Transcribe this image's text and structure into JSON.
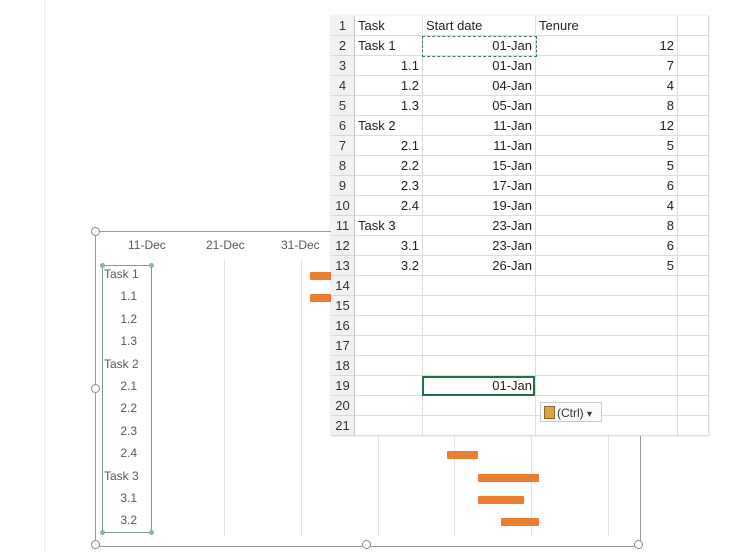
{
  "sheet": {
    "header": {
      "num": "1",
      "a": "Task",
      "b": "Start date",
      "c": "Tenure"
    },
    "rows": [
      {
        "num": "2",
        "a": "Task 1",
        "b": "01-Jan",
        "c": "12",
        "indent": false
      },
      {
        "num": "3",
        "a": "1.1",
        "b": "01-Jan",
        "c": "7",
        "indent": true
      },
      {
        "num": "4",
        "a": "1.2",
        "b": "04-Jan",
        "c": "4",
        "indent": true
      },
      {
        "num": "5",
        "a": "1.3",
        "b": "05-Jan",
        "c": "8",
        "indent": true
      },
      {
        "num": "6",
        "a": "Task 2",
        "b": "11-Jan",
        "c": "12",
        "indent": false
      },
      {
        "num": "7",
        "a": "2.1",
        "b": "11-Jan",
        "c": "5",
        "indent": true
      },
      {
        "num": "8",
        "a": "2.2",
        "b": "15-Jan",
        "c": "5",
        "indent": true
      },
      {
        "num": "9",
        "a": "2.3",
        "b": "17-Jan",
        "c": "6",
        "indent": true
      },
      {
        "num": "10",
        "a": "2.4",
        "b": "19-Jan",
        "c": "4",
        "indent": true
      },
      {
        "num": "11",
        "a": "Task 3",
        "b": "23-Jan",
        "c": "8",
        "indent": false
      },
      {
        "num": "12",
        "a": "3.1",
        "b": "23-Jan",
        "c": "6",
        "indent": true
      },
      {
        "num": "13",
        "a": "3.2",
        "b": "26-Jan",
        "c": "5",
        "indent": true
      },
      {
        "num": "14",
        "a": "",
        "b": "",
        "c": "",
        "indent": false
      },
      {
        "num": "15",
        "a": "",
        "b": "",
        "c": "",
        "indent": false
      },
      {
        "num": "16",
        "a": "",
        "b": "",
        "c": "",
        "indent": false
      },
      {
        "num": "17",
        "a": "",
        "b": "",
        "c": "",
        "indent": false
      },
      {
        "num": "18",
        "a": "",
        "b": "",
        "c": "",
        "indent": false
      },
      {
        "num": "19",
        "a": "",
        "b": "01-Jan",
        "c": "",
        "indent": false
      },
      {
        "num": "20",
        "a": "",
        "b": "",
        "c": "",
        "indent": false
      },
      {
        "num": "21",
        "a": "",
        "b": "",
        "c": "",
        "indent": false
      }
    ],
    "paste_options_label": "(Ctrl)",
    "paste_options_arrow": "▾"
  },
  "chart_data": {
    "type": "bar",
    "orientation": "horizontal-gantt",
    "x_ticks": [
      "11-Dec",
      "21-Dec",
      "31-Dec"
    ],
    "categories": [
      "Task 1",
      "1.1",
      "1.2",
      "1.3",
      "Task 2",
      "2.1",
      "2.2",
      "2.3",
      "2.4",
      "Task 3",
      "3.1",
      "3.2"
    ],
    "series": [
      {
        "start_days_from_31_dec": [
          1,
          1,
          4,
          5,
          11,
          11,
          15,
          17,
          19,
          23,
          23,
          26
        ],
        "tenure_days": [
          12,
          7,
          4,
          8,
          12,
          5,
          5,
          6,
          4,
          8,
          6,
          5
        ]
      }
    ],
    "visible_bars": [
      0,
      1,
      8,
      9,
      10,
      11
    ],
    "bar_color": "#ed7d31"
  }
}
